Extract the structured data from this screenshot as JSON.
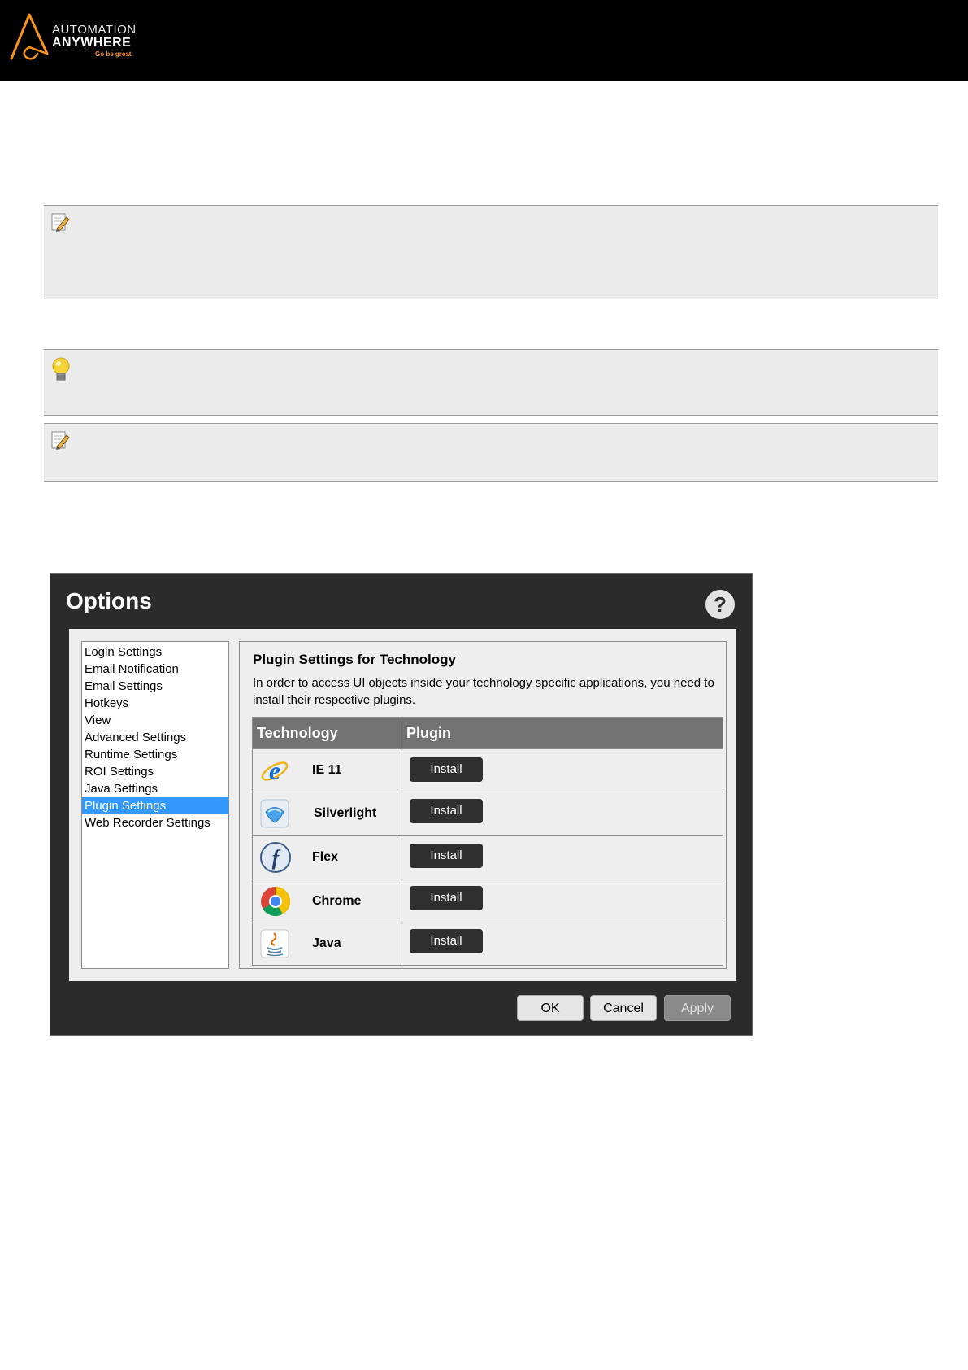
{
  "header": {
    "logo_line1": "AUTOMATION",
    "logo_line2": "ANYWHERE",
    "logo_tagline": "Go be great.",
    "brand_color": "#f7941d"
  },
  "notes": [
    {
      "icon": "pencil-note-icon"
    },
    {
      "icon": "lightbulb-tip-icon"
    },
    {
      "icon": "pencil-note-icon"
    }
  ],
  "dialog": {
    "title": "Options",
    "help_label": "?",
    "nav_items": [
      "Login Settings",
      "Email Notification",
      "Email Settings",
      "Hotkeys",
      "View",
      "Advanced Settings",
      "Runtime Settings",
      "ROI Settings",
      "Java Settings",
      "Plugin Settings",
      "Web Recorder Settings"
    ],
    "selected_nav": "Plugin Settings",
    "panel_title": "Plugin Settings for Technology",
    "panel_description": "In order to access UI objects inside your technology specific applications, you need to install their respective plugins.",
    "table_headers": {
      "technology": "Technology",
      "plugin": "Plugin"
    },
    "technologies": [
      {
        "name": "IE 11",
        "icon": "internet-explorer-icon",
        "button": "Install"
      },
      {
        "name": "Silverlight",
        "icon": "silverlight-icon",
        "button": "Install"
      },
      {
        "name": "Flex",
        "icon": "flex-icon",
        "button": "Install"
      },
      {
        "name": "Chrome",
        "icon": "chrome-icon",
        "button": "Install"
      },
      {
        "name": "Java",
        "icon": "java-icon",
        "button": "Install"
      }
    ],
    "ok_label": "OK",
    "cancel_label": "Cancel",
    "apply_label": "Apply"
  }
}
